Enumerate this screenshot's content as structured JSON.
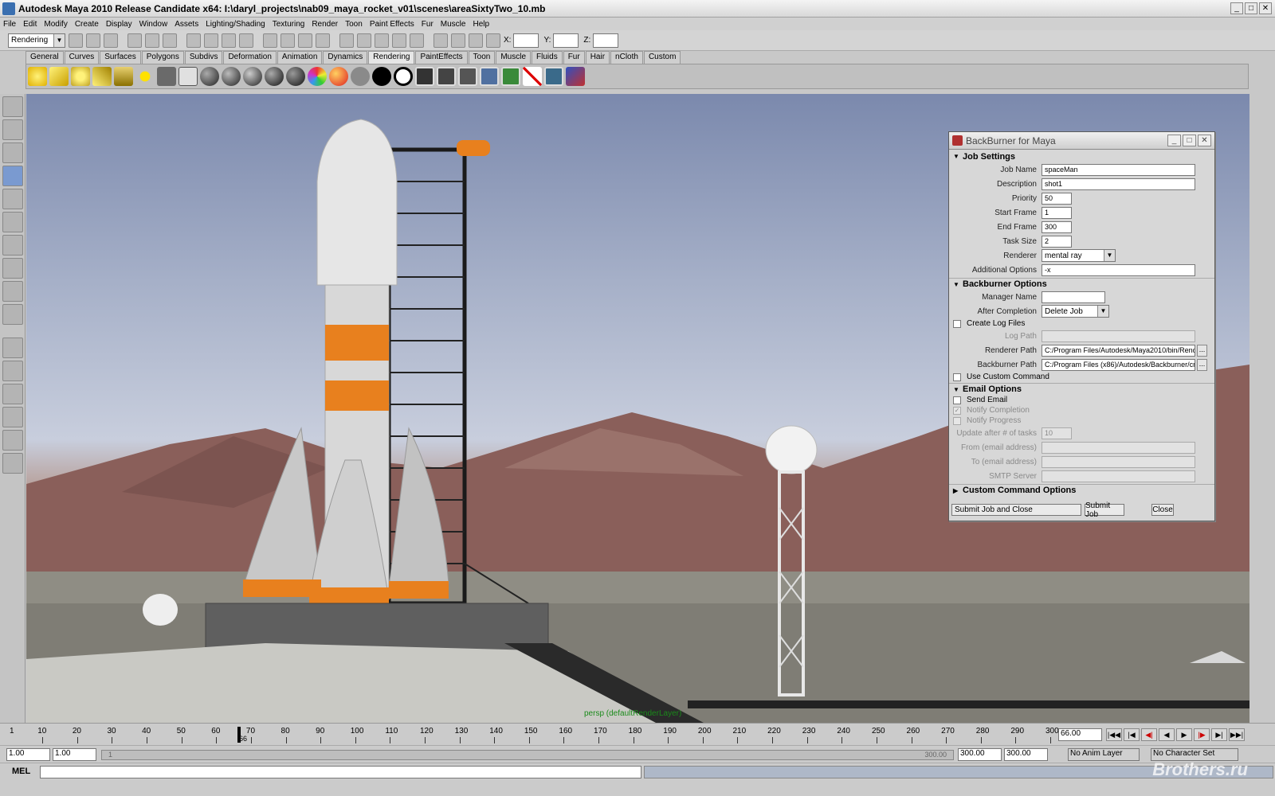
{
  "window": {
    "title": "Autodesk Maya 2010 Release Candidate x64: I:\\daryl_projects\\nab09_maya_rocket_v01\\scenes\\areaSixtyTwo_10.mb",
    "min": "_",
    "max": "□",
    "close": "✕"
  },
  "menus": [
    "File",
    "Edit",
    "Modify",
    "Create",
    "Display",
    "Window",
    "Assets",
    "Lighting/Shading",
    "Texturing",
    "Render",
    "Toon",
    "Paint Effects",
    "Fur",
    "Muscle",
    "Help"
  ],
  "statusline": {
    "menuset": "Rendering",
    "x_label": "X:",
    "y_label": "Y:",
    "z_label": "Z:"
  },
  "shelf_tabs": [
    "General",
    "Curves",
    "Surfaces",
    "Polygons",
    "Subdivs",
    "Deformation",
    "Animation",
    "Dynamics",
    "Rendering",
    "PaintEffects",
    "Toon",
    "Muscle",
    "Fluids",
    "Fur",
    "Hair",
    "nCloth",
    "Custom"
  ],
  "active_shelf": "Rendering",
  "viewport": {
    "camera_label": "persp (defaultRenderLayer)"
  },
  "dialog": {
    "title": "BackBurner for Maya",
    "min": "_",
    "max": "□",
    "close": "✕",
    "job_settings": {
      "header": "Job Settings",
      "job_name_label": "Job Name",
      "job_name": "spaceMan",
      "description_label": "Description",
      "description": "shot1",
      "priority_label": "Priority",
      "priority": "50",
      "start_frame_label": "Start Frame",
      "start_frame": "1",
      "end_frame_label": "End Frame",
      "end_frame": "300",
      "task_size_label": "Task Size",
      "task_size": "2",
      "renderer_label": "Renderer",
      "renderer": "mental ray",
      "additional_options_label": "Additional Options",
      "additional_options": "-x"
    },
    "backburner_options": {
      "header": "Backburner Options",
      "manager_name_label": "Manager Name",
      "manager_name": "",
      "after_completion_label": "After Completion",
      "after_completion": "Delete Job",
      "create_log_files": "Create Log Files",
      "log_path_label": "Log Path",
      "renderer_path_label": "Renderer Path",
      "renderer_path": "C:/Program Files/Autodesk/Maya2010/bin/Renc",
      "backburner_path_label": "Backburner Path",
      "backburner_path": "C:/Program Files (x86)/Autodesk/Backburner/cm",
      "use_custom_command": "Use Custom Command",
      "browse": "..."
    },
    "email_options": {
      "header": "Email Options",
      "send_email": "Send Email",
      "notify_completion": "Notify Completion",
      "notify_progress": "Notify Progress",
      "update_after_label": "Update after # of tasks",
      "update_after": "10",
      "from_label": "From (email address)",
      "to_label": "To (email address)",
      "smtp_label": "SMTP Server"
    },
    "custom_command_options": {
      "header": "Custom Command Options"
    },
    "buttons": {
      "submit_close": "Submit Job and Close",
      "submit": "Submit Job",
      "close": "Close"
    }
  },
  "timeline": {
    "ticks": [
      10,
      20,
      30,
      40,
      50,
      60,
      70,
      80,
      90,
      100,
      110,
      120,
      130,
      140,
      150,
      160,
      170,
      180,
      190,
      200,
      210,
      220,
      230,
      240,
      250,
      260,
      270,
      280,
      290,
      300
    ],
    "start_tick": "1",
    "current_marker": "66",
    "current_frame": "66.00"
  },
  "range": {
    "start": "1.00",
    "playback_start": "1.00",
    "slider_start": "1",
    "slider_end": "300.00",
    "playback_end": "300.00",
    "end": "300.00",
    "anim_layer": "No Anim Layer",
    "character_set": "No Character Set"
  },
  "command_line": {
    "label": "MEL"
  },
  "watermark": "Brothers.ru",
  "colors": {
    "accent_orange": "#e8801e",
    "sky": "#8fa0bf",
    "ground": "#8e6e68"
  }
}
